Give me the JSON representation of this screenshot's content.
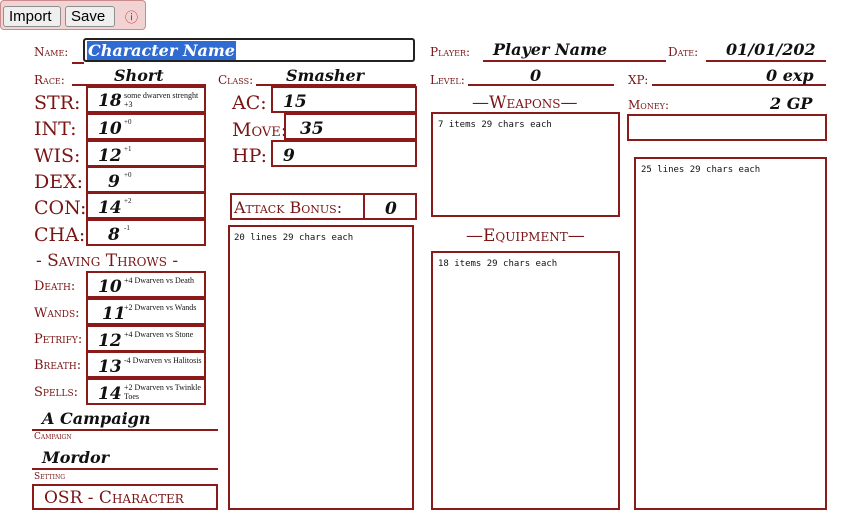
{
  "toolbar": {
    "import_label": "Import",
    "save_label": "Save",
    "warning_icon": "ⓘ"
  },
  "header": {
    "name_label": "Name:",
    "name_value": "Character Name",
    "player_label": "Player:",
    "player_value": "Player Name",
    "date_label": "Date:",
    "date_value": "01/01/202",
    "race_label": "Race:",
    "race_value": "Short",
    "class_label": "Class:",
    "class_value": "Smasher",
    "level_label": "Level:",
    "level_value": "0",
    "xp_label": "XP:",
    "xp_value": "0 exp",
    "money_label": "Money:",
    "money_value": "2 GP"
  },
  "stats": [
    {
      "label": "STR:",
      "value": "18",
      "note": "some dwarven strenght +3"
    },
    {
      "label": "INT:",
      "value": "10",
      "note": "+0"
    },
    {
      "label": "WIS:",
      "value": "12",
      "note": "+1"
    },
    {
      "label": "DEX:",
      "value": "9",
      "note": "+0"
    },
    {
      "label": "CON:",
      "value": "14",
      "note": "+2"
    },
    {
      "label": "CHA:",
      "value": "8",
      "note": "-1"
    }
  ],
  "combat": {
    "ac_label": "AC:",
    "ac_value": "15",
    "move_label": "Move:",
    "move_value": "35",
    "hp_label": "HP:",
    "hp_value": "9",
    "attack_label": "Attack Bonus:",
    "attack_value": "0"
  },
  "saving_throws": {
    "title": "- Saving Throws -",
    "items": [
      {
        "label": "Death:",
        "value": "10",
        "note": "+4 Dwarven vs Death"
      },
      {
        "label": "Wands:",
        "value": "11",
        "note": "+2 Dwarven vs Wands"
      },
      {
        "label": "Petrify:",
        "value": "12",
        "note": "+4 Dwarven vs Stone"
      },
      {
        "label": "Breath:",
        "value": "13",
        "note": "-4 Dwarven vs Halitosis"
      },
      {
        "label": "Spells:",
        "value": "14",
        "note": "+2 Dwarven vs Twinkle Toes"
      }
    ]
  },
  "campaign": {
    "value": "A Campaign",
    "label": "Campaign"
  },
  "setting": {
    "value": "Mordor",
    "label": "Setting"
  },
  "footer_title": "OSR - Character",
  "weapons": {
    "title": "—Weapons—",
    "placeholder": "7 items 29 chars each"
  },
  "equipment": {
    "title": "—Equipment—",
    "placeholder": "18 items 29 chars each"
  },
  "notes": {
    "placeholder": "20 lines 29 chars each"
  },
  "money_box": {
    "value": ""
  },
  "inventory": {
    "placeholder": "25 lines 29 chars each"
  }
}
